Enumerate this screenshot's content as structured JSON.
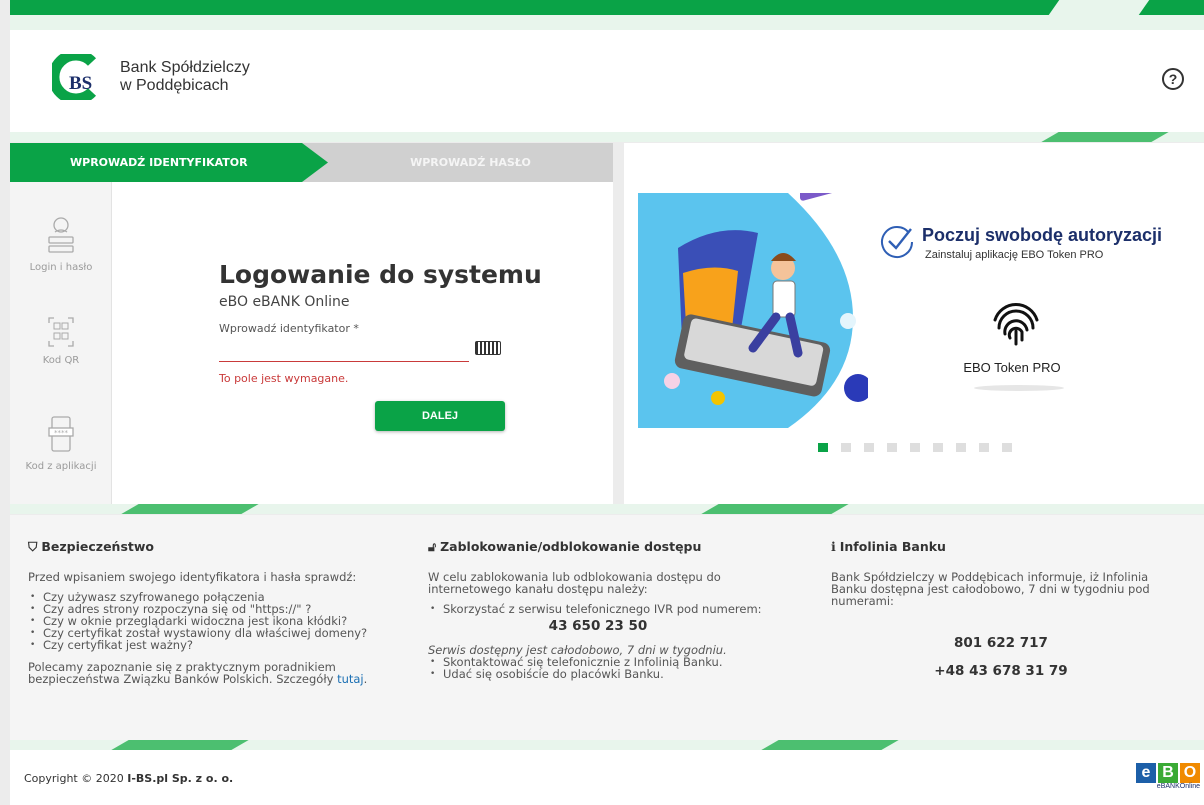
{
  "bank": {
    "name_line1": "Bank Spółdzielczy",
    "name_line2": "w Poddębicach",
    "logo_letters": "BS"
  },
  "header": {
    "help_label": "?"
  },
  "steps": {
    "step1": "WPROWADŹ IDENTYFIKATOR",
    "step2": "WPROWADŹ HASŁO"
  },
  "methods": [
    {
      "label": "Login i hasło",
      "icon": "user-password-icon"
    },
    {
      "label": "Kod QR",
      "icon": "qr-code-icon"
    },
    {
      "label": "Kod z aplikacji",
      "icon": "mobile-app-icon"
    }
  ],
  "login": {
    "title": "Logowanie do systemu",
    "subtitle": "eBO eBANK Online",
    "id_label": "Wprowadź identyfikator *",
    "id_value": "",
    "error": "To pole jest wymagane.",
    "submit": "DALEJ"
  },
  "promo": {
    "title": "Poczuj swobodę autoryzacji",
    "subtitle": "Zainstaluj aplikację EBO Token PRO",
    "token_name": "EBO Token PRO",
    "slides_total": 9,
    "active_slide": 1
  },
  "security": {
    "title": "Bezpieczeństwo",
    "intro": "Przed wpisaniem swojego identyfikatora i hasła sprawdź:",
    "items": [
      "Czy używasz szyfrowanego połączenia",
      "Czy adres strony rozpoczyna się od \"https://\" ?",
      "Czy w oknie przeglądarki widoczna jest ikona kłódki?",
      "Czy certyfikat został wystawiony dla właściwej domeny?",
      "Czy certyfikat jest ważny?"
    ],
    "outro_line1": "Polecamy zapoznanie się z praktycznym poradnikiem",
    "outro_line2": "bezpieczeństwa Związku Banków Polskich. Szczegóły",
    "link": "tutaj",
    "link_suffix": "."
  },
  "block": {
    "title": "Zablokowanie/odblokowanie dostępu",
    "intro_line1": "W celu zablokowania lub odblokowania dostępu do",
    "intro_line2": "internetowego kanału dostępu należy:",
    "ivr_item": "Skorzystać z serwisu telefonicznego IVR pod numerem:",
    "ivr_number": "43 650 23 50",
    "note": "Serwis dostępny jest całodobowo, 7 dni w tygodniu.",
    "items": [
      "Skontaktować się telefonicznie z Infolinią Banku.",
      "Udać się osobiście do placówki Banku."
    ]
  },
  "hotline": {
    "title": "Infolinia Banku",
    "line1": "Bank Spółdzielczy w Poddębicach informuje, iż Infolinia",
    "line2": "Banku dostępna jest całodobowo, 7 dni w tygodniu pod",
    "line3": "numerami:",
    "phone1": "801 622 717",
    "phone2": "+48 43 678 31 79"
  },
  "footer": {
    "copyright_prefix": "Copyright © 2020",
    "company": "I-BS.pl Sp. z o. o.",
    "ebo_tag": "eBANKOnline"
  },
  "colors": {
    "brand_green": "#0aa347",
    "navy": "#1c2f6a",
    "error_red": "#c93a3a",
    "ebo_blue": "#1c5fa8",
    "ebo_green": "#3aaa35",
    "ebo_orange": "#f08a00"
  }
}
